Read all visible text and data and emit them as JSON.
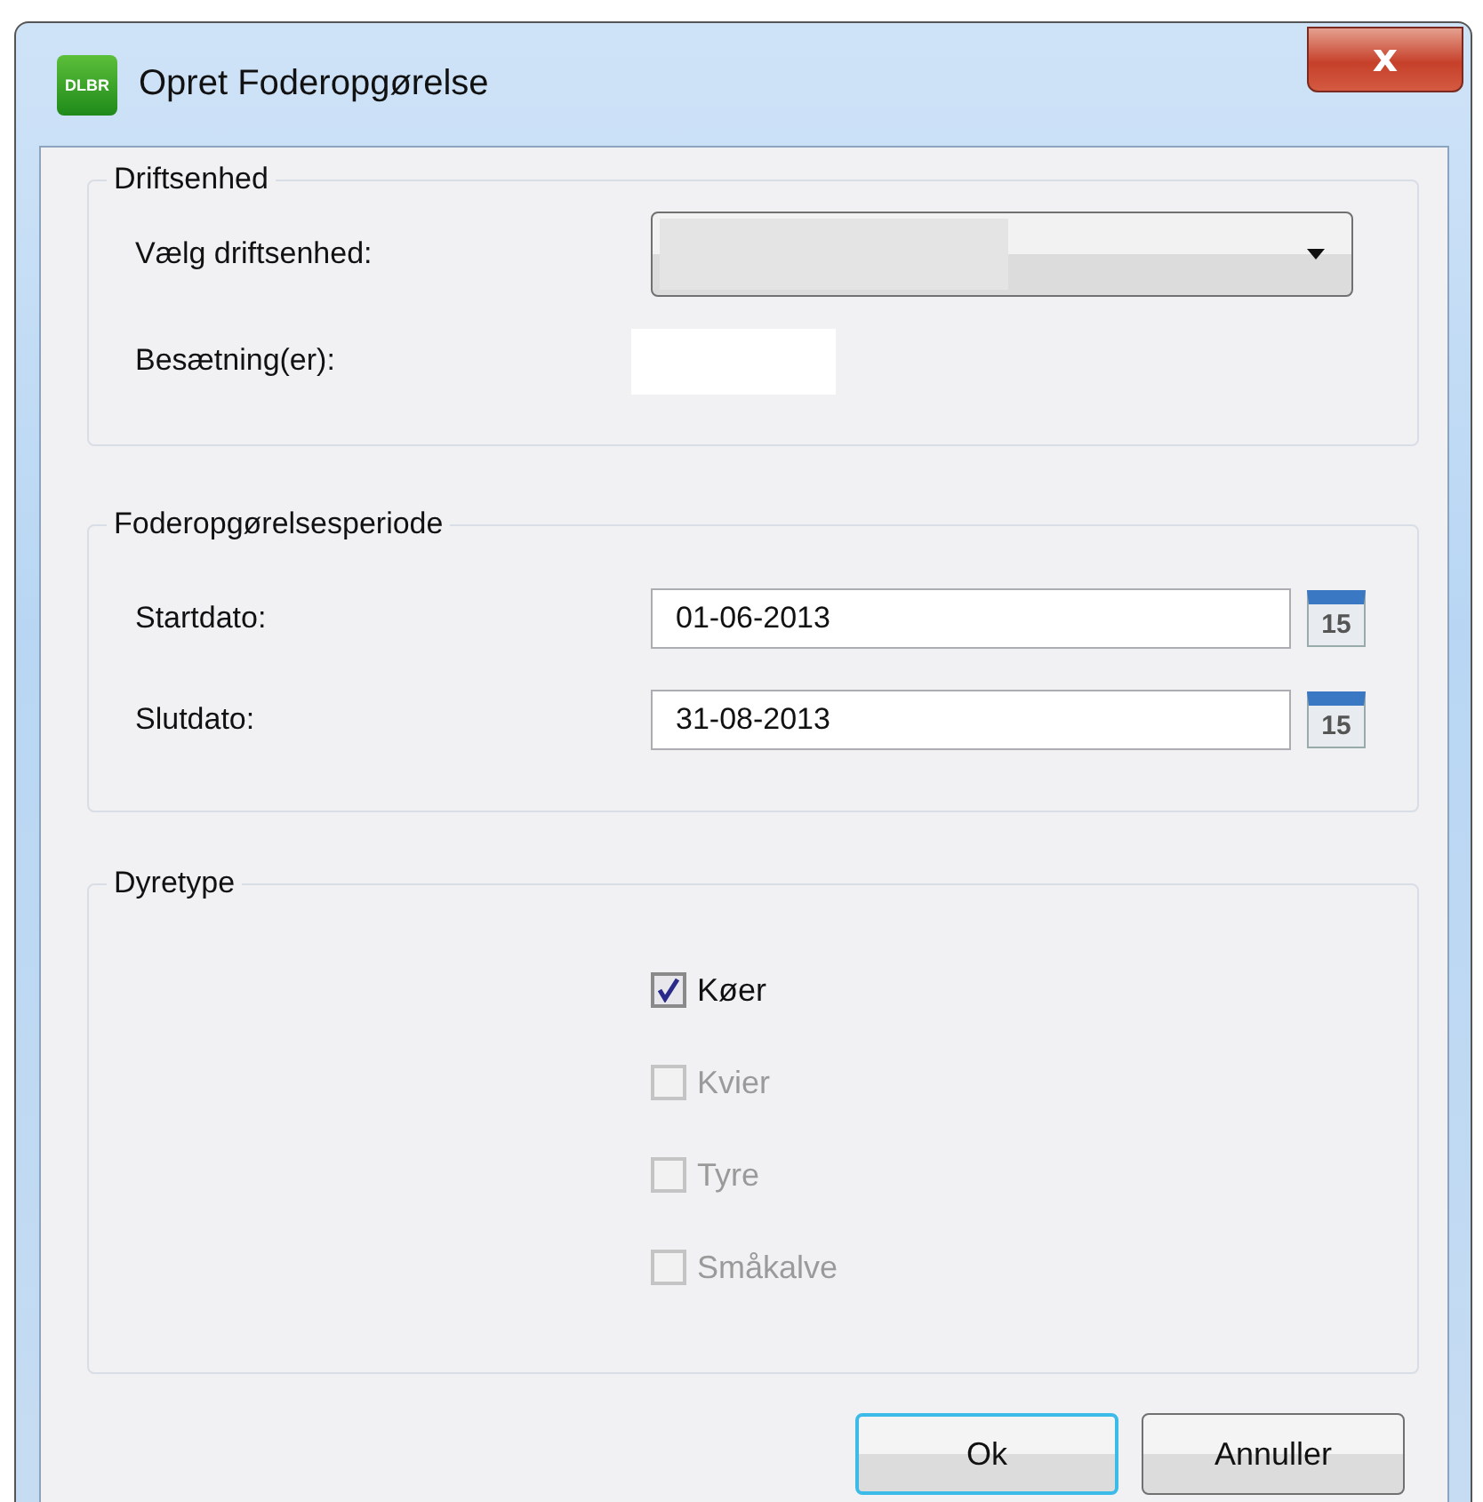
{
  "window": {
    "app_icon": "DLBR",
    "title": "Opret Foderopgørelse",
    "close": "x"
  },
  "driftsenhed": {
    "legend": "Driftsenhed",
    "select_label": "Vælg driftsenhed:",
    "herd_label": "Besætning(er):"
  },
  "periode": {
    "legend": "Foderopgørelsesperiode",
    "fields": [
      {
        "label": "Startdato:",
        "value": "01-06-2013",
        "icon_text": "15"
      },
      {
        "label": "Slutdato:",
        "value": "31-08-2013",
        "icon_text": "15"
      }
    ]
  },
  "dyretype": {
    "legend": "Dyretype",
    "options": [
      {
        "label": "Køer",
        "checked": true,
        "disabled": false
      },
      {
        "label": "Kvier",
        "checked": false,
        "disabled": true
      },
      {
        "label": "Tyre",
        "checked": false,
        "disabled": true
      },
      {
        "label": "Småkalve",
        "checked": false,
        "disabled": true
      }
    ]
  },
  "buttons": [
    {
      "label": "Ok",
      "default": true
    },
    {
      "label": "Annuller",
      "default": false
    }
  ]
}
